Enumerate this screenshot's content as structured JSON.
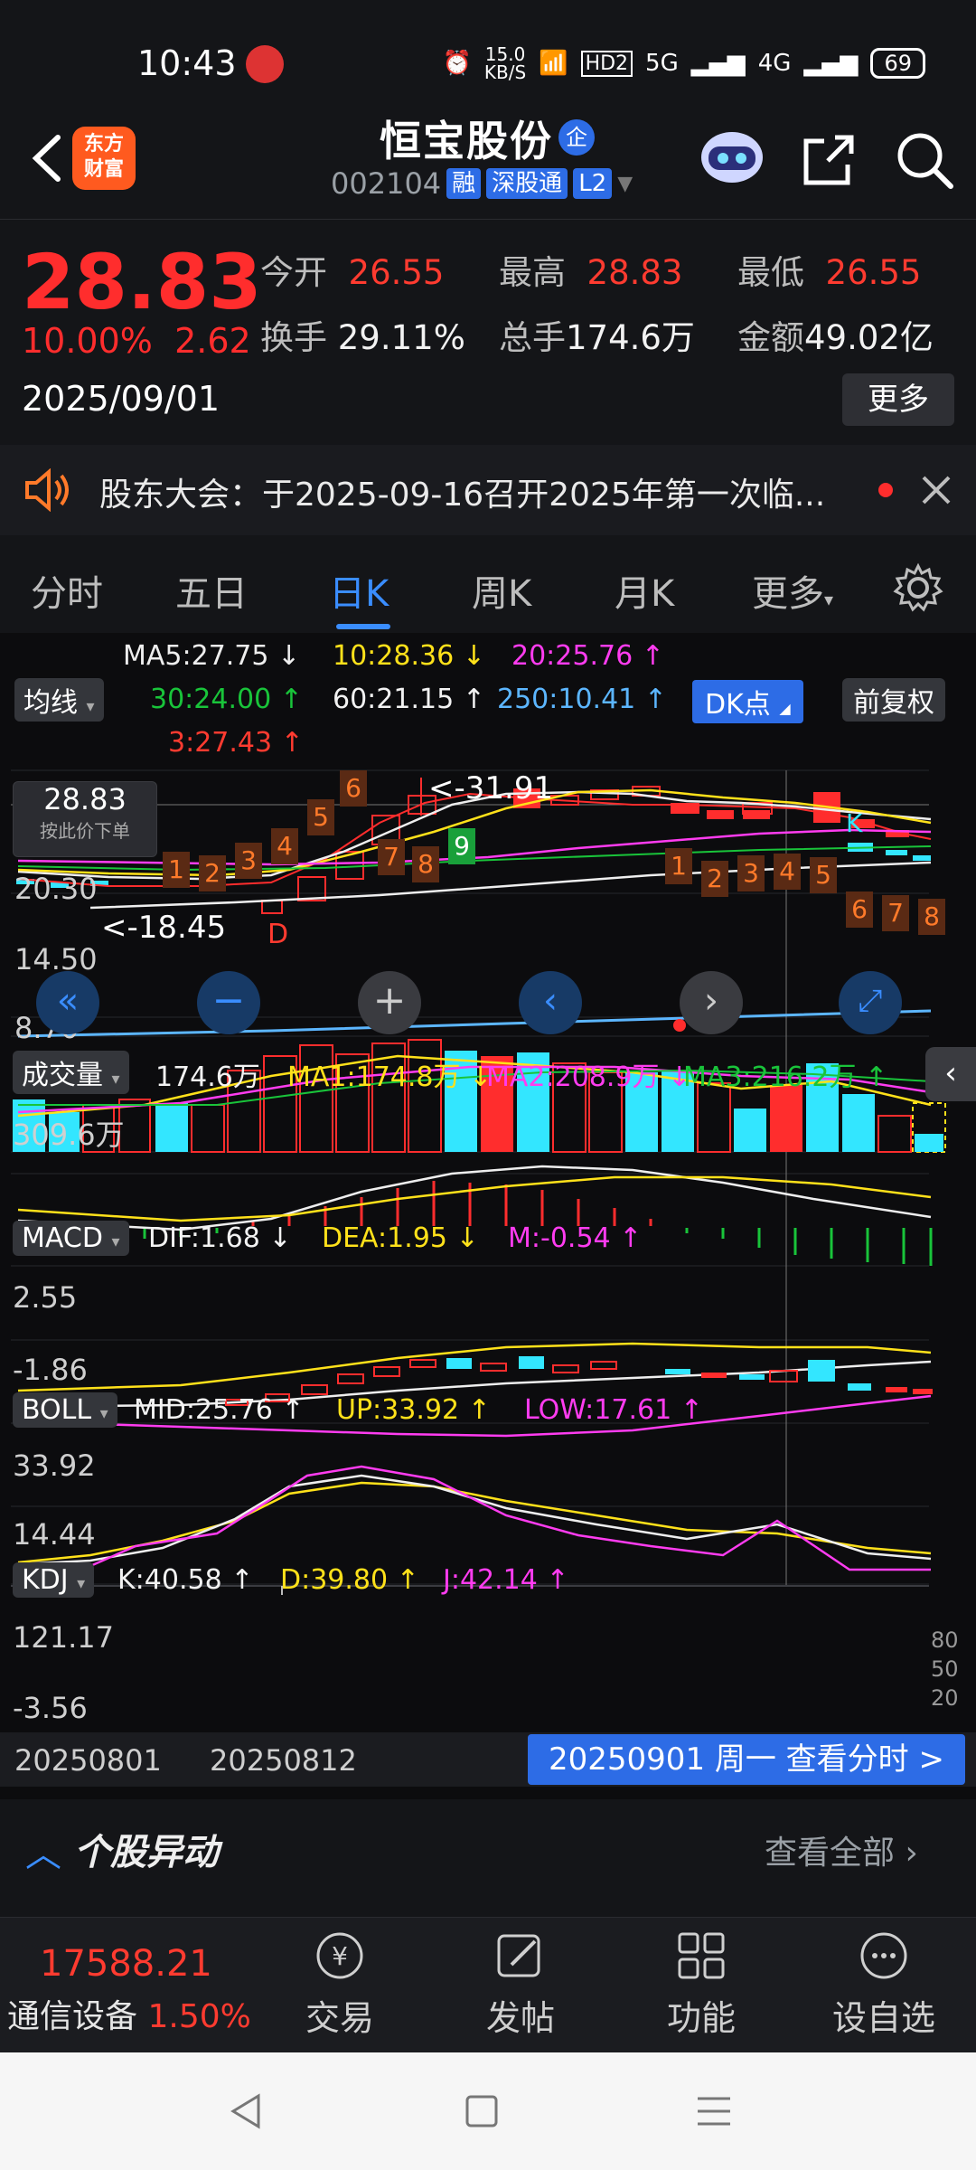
{
  "status": {
    "time": "10:43",
    "net_speed_top": "15.0",
    "net_speed_unit": "KB/S",
    "hd": "HD2",
    "sig1": "5G",
    "sig2": "4G",
    "battery": "69"
  },
  "header": {
    "logo_line1": "东方",
    "logo_line2": "财富",
    "stock_name": "恒宝股份",
    "name_badge": "企",
    "stock_code": "002104",
    "tag1": "融",
    "tag2": "深股通",
    "tag3": "L2"
  },
  "quote": {
    "price": "28.83",
    "change_pct": "10.00%",
    "change_val": "2.62",
    "date": "2025/09/01",
    "open_label": "今开",
    "open": "26.55",
    "high_label": "最高",
    "high": "28.83",
    "low_label": "最低",
    "low": "26.55",
    "turnover_label": "换手",
    "turnover": "29.11%",
    "volume_label": "总手",
    "volume": "174.6万",
    "amount_label": "金额",
    "amount": "49.02亿",
    "more": "更多"
  },
  "notice": {
    "text": "股东大会：于2025-09-16召开2025年第一次临..."
  },
  "tabs": [
    "分时",
    "五日",
    "日K",
    "周K",
    "月K",
    "更多"
  ],
  "indicators": {
    "ma5": "MA5:27.75",
    "ma10": "10:28.36",
    "ma20": "20:25.76",
    "ma_btn": "均线",
    "ma30": "30:24.00",
    "ma60": "60:21.15",
    "ma250": "250:10.41",
    "ma3": "3:27.43",
    "dk_btn": "DK点",
    "fq_btn": "前复权"
  },
  "kline": {
    "price_box": "28.83",
    "price_box_hint": "按此价下单",
    "axis": [
      "20.30",
      "14.50",
      "8.70"
    ],
    "high_mark": "<-31.91",
    "low_mark": "<-18.45",
    "d_mark": "D",
    "k_mark": "K",
    "seq_up": [
      "1",
      "2",
      "3",
      "4",
      "5",
      "6",
      "7",
      "8",
      "9"
    ],
    "seq_down": [
      "1",
      "2",
      "3",
      "4",
      "5",
      "6",
      "7",
      "8"
    ]
  },
  "volume": {
    "btn": "成交量",
    "val": "174.6万",
    "ma1": "MA1:174.8万",
    "ma2": "MA2:208.9万",
    "ma3": "MA3:216.2万",
    "axis": "309.6万"
  },
  "macd": {
    "btn": "MACD",
    "dif": "DIF:1.68",
    "dea": "DEA:1.95",
    "m": "M:-0.54",
    "axis_top": "2.55",
    "axis_bot": "-1.86"
  },
  "boll": {
    "btn": "BOLL",
    "mid": "MID:25.76",
    "up": "UP:33.92",
    "low": "LOW:17.61",
    "axis_top": "33.92",
    "axis_bot": "14.44"
  },
  "kdj": {
    "btn": "KDJ",
    "k": "K:40.58",
    "d": "D:39.80",
    "j": "J:42.14",
    "axis_top": "121.17",
    "axis_bot": "-3.56",
    "lv80": "80",
    "lv50": "50",
    "lv20": "20"
  },
  "timeline": {
    "d1": "20250801",
    "d2": "20250812",
    "current": "20250901 周一 查看分时 >"
  },
  "stock_move": {
    "title": "个股异动",
    "view_all": "查看全部"
  },
  "bottom_bar": {
    "index_val": "17588.21",
    "index_name": "通信设备",
    "index_pct": "1.50%",
    "trade": "交易",
    "post": "发帖",
    "func": "功能",
    "watch": "设自选"
  },
  "colors": {
    "up": "#ff2d2d",
    "down": "#19c43a",
    "accent": "#3a8dff",
    "cyan": "#33e6ff"
  }
}
